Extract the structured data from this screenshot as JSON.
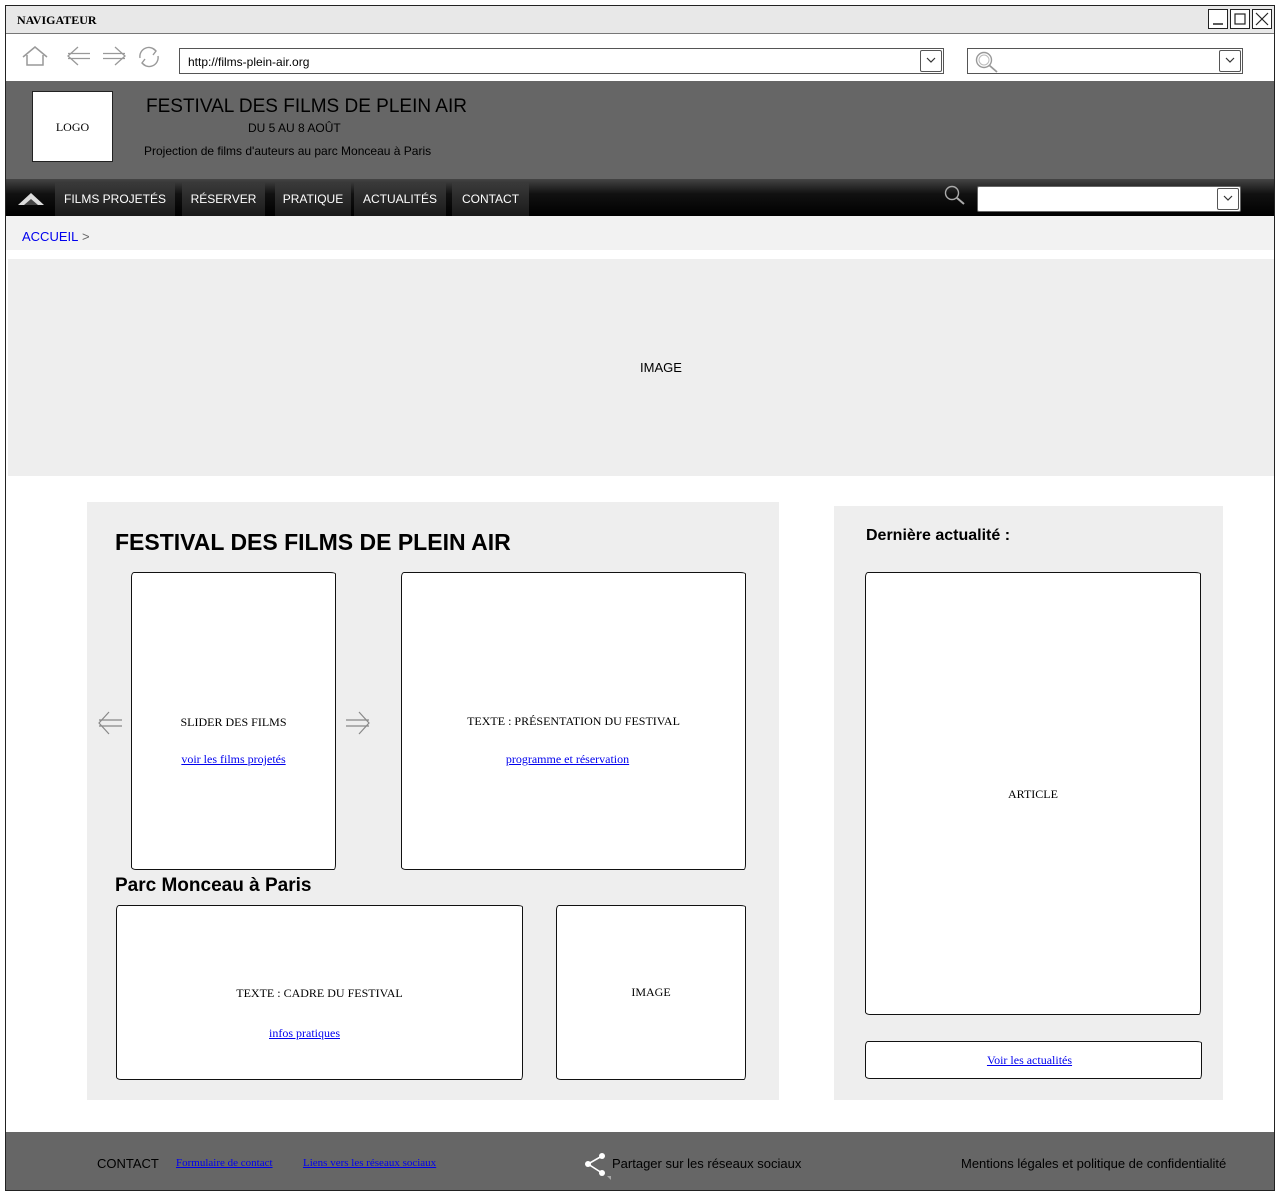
{
  "window": {
    "title": "NAVIGATEUR"
  },
  "browser": {
    "url": "http://films-plein-air.org",
    "search_value": ""
  },
  "header": {
    "logo": "LOGO",
    "title": "FESTIVAL DES FILMS DE PLEIN AIR",
    "dates": "DU 5 AU 8 AOÛT",
    "tagline": "Projection de films d'auteurs au parc Monceau à Paris"
  },
  "nav": {
    "items": [
      {
        "label": "FILMS PROJETÉS"
      },
      {
        "label": "RÉSERVER"
      },
      {
        "label": "PRATIQUE"
      },
      {
        "label": "ACTUALITÉS"
      },
      {
        "label": "CONTACT"
      }
    ],
    "search_value": ""
  },
  "breadcrumb": {
    "current": "ACCUEIL",
    "separator": ">"
  },
  "hero": {
    "label": "IMAGE"
  },
  "main": {
    "title": "FESTIVAL DES FILMS DE PLEIN AIR",
    "slider": {
      "label": "SLIDER DES FILMS",
      "link": "voir les films projetés"
    },
    "presentation": {
      "label": "TEXTE : PRÉSENTATION DU FESTIVAL",
      "link": "programme et réservation"
    },
    "subtitle": "Parc Monceau à Paris",
    "cadre": {
      "label": "TEXTE : CADRE DU FESTIVAL",
      "link": "infos pratiques"
    },
    "image": {
      "label": "IMAGE"
    }
  },
  "side": {
    "title": "Dernière actualité :",
    "article": "ARTICLE",
    "link": "Voir les actualités"
  },
  "footer": {
    "contact_label": "CONTACT",
    "contact_form": "Formulaire de contact",
    "social_links": "Liens vers les réseaux sociaux",
    "share": "Partager sur les réseaux sociaux",
    "legal": "Mentions légales et politique de confidentialité"
  },
  "icons": {
    "home": "home-icon",
    "back": "arrow-left-icon",
    "forward": "arrow-right-icon",
    "refresh": "refresh-icon",
    "search": "search-icon",
    "share": "share-icon"
  }
}
